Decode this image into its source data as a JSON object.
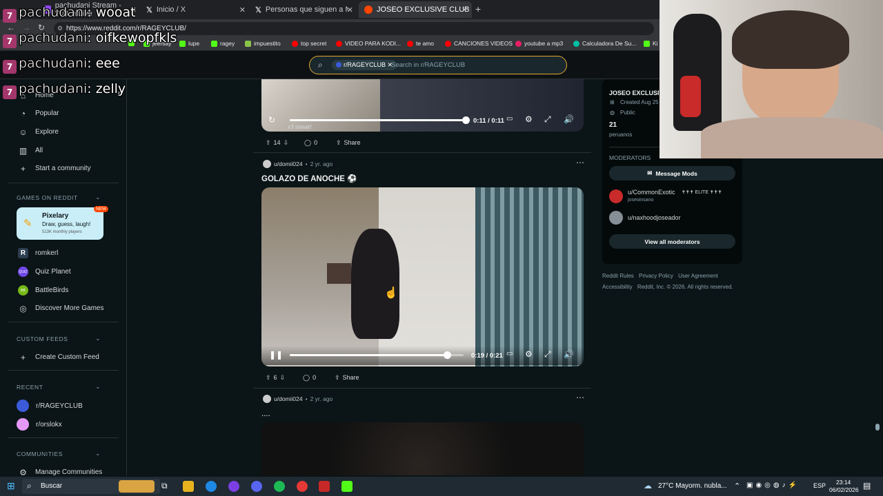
{
  "browser": {
    "tabs": [
      {
        "label": "pachudani Stream - Watch Live",
        "active": false
      },
      {
        "label": "Inicio / X",
        "active": false
      },
      {
        "label": "Personas que siguen a Momazos",
        "active": false
      },
      {
        "label": "JOSEO EXCLUSIVE CLUB",
        "active": true
      }
    ],
    "new_tab": "+",
    "url": "https://www.reddit.com/r/RAGEYCLUB/",
    "bookmarks": [
      {
        "label": "",
        "color": "#4caf50"
      },
      {
        "label": "jeersay",
        "color": "#53fc18"
      },
      {
        "label": "lupe",
        "color": "#53fc18"
      },
      {
        "label": "ragey",
        "color": "#53fc18"
      },
      {
        "label": "impuestito",
        "color": "#8bc34a"
      },
      {
        "label": "top secret",
        "color": "#ff0000"
      },
      {
        "label": "VIDEO PARA KODI...",
        "color": "#ff0000"
      },
      {
        "label": "te amo",
        "color": "#ff0000"
      },
      {
        "label": "CANCIONES VIDEOS",
        "color": "#ff0000"
      },
      {
        "label": "youtube a mp3",
        "color": "#e91e63"
      },
      {
        "label": "Calculadora De Su...",
        "color": "#00bfa5"
      },
      {
        "label": "Ki",
        "color": "#53fc18"
      }
    ]
  },
  "search": {
    "community_chip": "r/RAGEYCLUB",
    "placeholder": "Search in r/RAGEYCLUB"
  },
  "sidebar": {
    "nav": [
      {
        "label": "Home",
        "icon": "home-icon"
      },
      {
        "label": "Popular",
        "icon": "popular-icon"
      },
      {
        "label": "Explore",
        "icon": "explore-icon"
      },
      {
        "label": "All",
        "icon": "all-icon"
      },
      {
        "label": "Start a community",
        "icon": "plus-icon"
      }
    ],
    "games_header": "GAMES ON REDDIT",
    "featured_game": {
      "name": "Pixelary",
      "tagline": "Draw, guess, laugh!",
      "players": "513K monthly players",
      "badge": "NEW"
    },
    "games": [
      "romkerl",
      "Quiz Planet",
      "BattleBirds",
      "Discover More Games"
    ],
    "custom_feeds_header": "CUSTOM FEEDS",
    "create_custom_feed": "Create Custom Feed",
    "recent_header": "RECENT",
    "recent": [
      "r/RAGEYCLUB",
      "r/orslokx"
    ],
    "communities_header": "COMMUNITIES",
    "manage_communities": "Manage Communities"
  },
  "posts": [
    {
      "video": {
        "time": "0:11 / 0:11",
        "progress": 1.0,
        "overlay_text": "x3 streak!"
      },
      "votes": "14",
      "comments": "0",
      "share": "Share"
    },
    {
      "author": "u/domii024",
      "age": "2 yr. ago",
      "title": "GOLAZO DE ANOCHE",
      "video": {
        "time": "0:19 / 0:21",
        "progress": 0.905
      },
      "votes": "6",
      "comments": "0",
      "share": "Share"
    },
    {
      "author": "u/domii024",
      "age": "2 yr. ago",
      "title": "...."
    }
  ],
  "community_panel": {
    "name": "JOSEO EXCLUSIV",
    "created": "Created Aug 25",
    "visibility": "Public",
    "members": "21",
    "members_label": "peruanos",
    "moderators_header": "MODERATORS",
    "message_mods": "Message Mods",
    "moderators": [
      {
        "name": "u/CommonExotic",
        "flair": "✝✝✝ ELITE ✝✝✝",
        "sub": "joseoinsano"
      },
      {
        "name": "u/naxhoodjoseador",
        "flair": "",
        "sub": ""
      }
    ],
    "view_all": "View all moderators"
  },
  "footer": {
    "links": [
      "Reddit Rules",
      "Privacy Policy",
      "User Agreement",
      "Accessibility"
    ],
    "copyright": "Reddit, Inc. © 2026. All rights reserved."
  },
  "chat": [
    {
      "user": "pachudani",
      "message": ": wooat"
    },
    {
      "user": "pachudani",
      "message": ": oifkewopfkls"
    },
    {
      "user": "pachudani",
      "message": ": eee"
    },
    {
      "user": "pachudani",
      "message": ": zelly"
    }
  ],
  "taskbar": {
    "search": "Buscar",
    "weather": "27°C  Mayorm. nubla...",
    "lang": "ESP",
    "time": "23:14",
    "date": "06/02/2026"
  },
  "colors": {
    "accent": "#e3a82f",
    "bg": "#0b1416",
    "twitch": "#a3376c"
  }
}
